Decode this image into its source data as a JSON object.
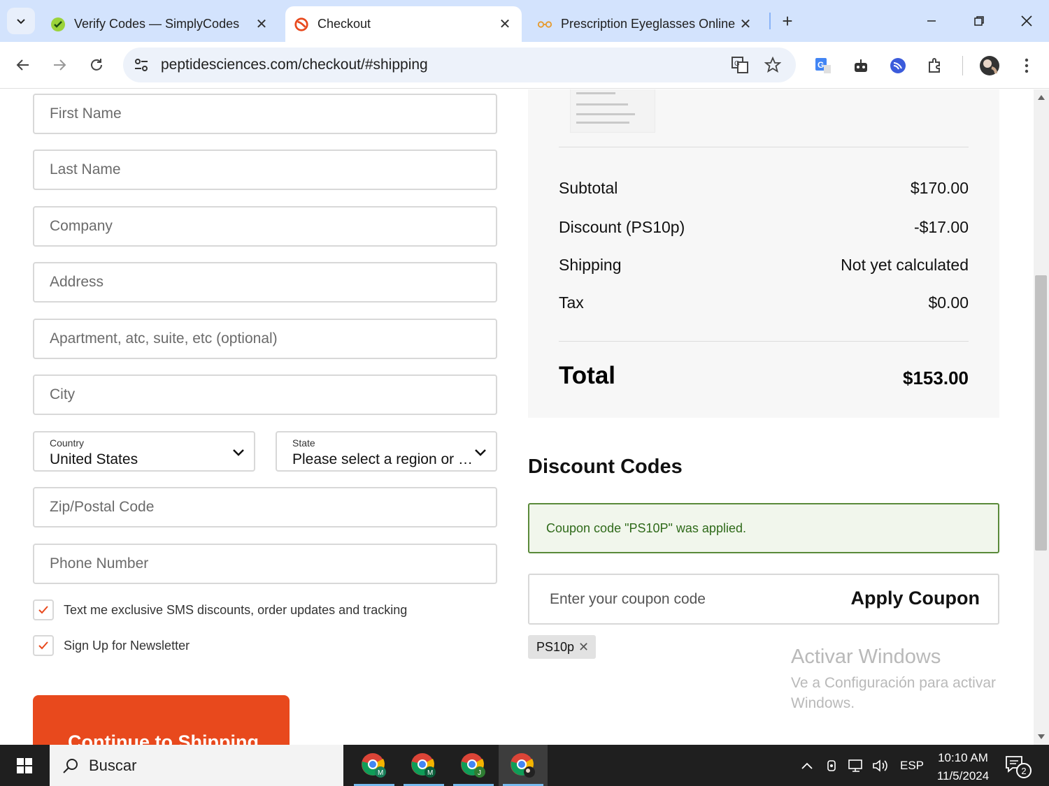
{
  "browser": {
    "tabs": [
      {
        "title": "Verify Codes — SimplyCodes",
        "icon": "simplycodes-icon",
        "active": false
      },
      {
        "title": "Checkout",
        "icon": "peptide-sciences-icon",
        "active": true
      },
      {
        "title": "Prescription Eyeglasses Online F",
        "icon": "eyeglasses-icon",
        "active": false
      }
    ],
    "url": "peptidesciences.com/checkout/#shipping"
  },
  "form": {
    "first_name_placeholder": "First Name",
    "last_name_placeholder": "Last Name",
    "company_placeholder": "Company",
    "address_placeholder": "Address",
    "apartment_placeholder": "Apartment, atc, suite, etc (optional)",
    "city_placeholder": "City",
    "country_label": "Country",
    "country_value": "United States",
    "state_label": "State",
    "state_value": "Please select a region or state",
    "zip_placeholder": "Zip/Postal Code",
    "phone_placeholder": "Phone Number",
    "sms_label": "Text me exclusive SMS discounts, order updates and tracking",
    "sms_checked": true,
    "newsletter_label": "Sign Up for Newsletter",
    "newsletter_checked": true,
    "continue_label": "Continue to Shipping"
  },
  "summary": {
    "subtotal_label": "Subtotal",
    "subtotal_value": "$170.00",
    "discount_label": "Discount (PS10p)",
    "discount_value": "-$17.00",
    "shipping_label": "Shipping",
    "shipping_value": "Not yet calculated",
    "tax_label": "Tax",
    "tax_value": "$0.00",
    "total_label": "Total",
    "total_value": "$153.00"
  },
  "discounts": {
    "heading": "Discount Codes",
    "notice": "Coupon code \"PS10P\" was applied.",
    "input_placeholder": "Enter your coupon code",
    "apply_label": "Apply Coupon",
    "applied_code": "PS10p"
  },
  "watermark": {
    "title": "Activar Windows",
    "subtitle": "Ve a Configuración para activar Windows."
  },
  "taskbar": {
    "search_label": "Buscar",
    "language": "ESP",
    "time": "10:10 AM",
    "date": "11/5/2024",
    "notification_count": "2",
    "apps": [
      {
        "name": "chrome-profile-m-1",
        "badge": "M"
      },
      {
        "name": "chrome-profile-m-2",
        "badge": "M"
      },
      {
        "name": "chrome-profile-j",
        "badge": "J"
      },
      {
        "name": "chrome-profile-avatar",
        "badge": ""
      }
    ]
  },
  "colors": {
    "accent": "#e8491d",
    "notice_border": "#5a8a3a",
    "notice_text": "#2f6a1a",
    "tabstrip": "#d3e3fd"
  }
}
